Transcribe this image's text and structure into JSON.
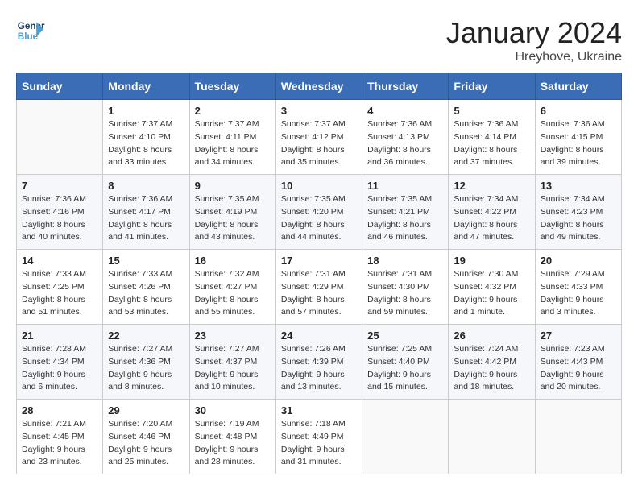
{
  "header": {
    "logo_line1": "General",
    "logo_line2": "Blue",
    "month_year": "January 2024",
    "location": "Hreyhove, Ukraine"
  },
  "days_of_week": [
    "Sunday",
    "Monday",
    "Tuesday",
    "Wednesday",
    "Thursday",
    "Friday",
    "Saturday"
  ],
  "weeks": [
    [
      {
        "day": "",
        "sunrise": "",
        "sunset": "",
        "daylight": ""
      },
      {
        "day": "1",
        "sunrise": "Sunrise: 7:37 AM",
        "sunset": "Sunset: 4:10 PM",
        "daylight": "Daylight: 8 hours and 33 minutes."
      },
      {
        "day": "2",
        "sunrise": "Sunrise: 7:37 AM",
        "sunset": "Sunset: 4:11 PM",
        "daylight": "Daylight: 8 hours and 34 minutes."
      },
      {
        "day": "3",
        "sunrise": "Sunrise: 7:37 AM",
        "sunset": "Sunset: 4:12 PM",
        "daylight": "Daylight: 8 hours and 35 minutes."
      },
      {
        "day": "4",
        "sunrise": "Sunrise: 7:36 AM",
        "sunset": "Sunset: 4:13 PM",
        "daylight": "Daylight: 8 hours and 36 minutes."
      },
      {
        "day": "5",
        "sunrise": "Sunrise: 7:36 AM",
        "sunset": "Sunset: 4:14 PM",
        "daylight": "Daylight: 8 hours and 37 minutes."
      },
      {
        "day": "6",
        "sunrise": "Sunrise: 7:36 AM",
        "sunset": "Sunset: 4:15 PM",
        "daylight": "Daylight: 8 hours and 39 minutes."
      }
    ],
    [
      {
        "day": "7",
        "sunrise": "Sunrise: 7:36 AM",
        "sunset": "Sunset: 4:16 PM",
        "daylight": "Daylight: 8 hours and 40 minutes."
      },
      {
        "day": "8",
        "sunrise": "Sunrise: 7:36 AM",
        "sunset": "Sunset: 4:17 PM",
        "daylight": "Daylight: 8 hours and 41 minutes."
      },
      {
        "day": "9",
        "sunrise": "Sunrise: 7:35 AM",
        "sunset": "Sunset: 4:19 PM",
        "daylight": "Daylight: 8 hours and 43 minutes."
      },
      {
        "day": "10",
        "sunrise": "Sunrise: 7:35 AM",
        "sunset": "Sunset: 4:20 PM",
        "daylight": "Daylight: 8 hours and 44 minutes."
      },
      {
        "day": "11",
        "sunrise": "Sunrise: 7:35 AM",
        "sunset": "Sunset: 4:21 PM",
        "daylight": "Daylight: 8 hours and 46 minutes."
      },
      {
        "day": "12",
        "sunrise": "Sunrise: 7:34 AM",
        "sunset": "Sunset: 4:22 PM",
        "daylight": "Daylight: 8 hours and 47 minutes."
      },
      {
        "day": "13",
        "sunrise": "Sunrise: 7:34 AM",
        "sunset": "Sunset: 4:23 PM",
        "daylight": "Daylight: 8 hours and 49 minutes."
      }
    ],
    [
      {
        "day": "14",
        "sunrise": "Sunrise: 7:33 AM",
        "sunset": "Sunset: 4:25 PM",
        "daylight": "Daylight: 8 hours and 51 minutes."
      },
      {
        "day": "15",
        "sunrise": "Sunrise: 7:33 AM",
        "sunset": "Sunset: 4:26 PM",
        "daylight": "Daylight: 8 hours and 53 minutes."
      },
      {
        "day": "16",
        "sunrise": "Sunrise: 7:32 AM",
        "sunset": "Sunset: 4:27 PM",
        "daylight": "Daylight: 8 hours and 55 minutes."
      },
      {
        "day": "17",
        "sunrise": "Sunrise: 7:31 AM",
        "sunset": "Sunset: 4:29 PM",
        "daylight": "Daylight: 8 hours and 57 minutes."
      },
      {
        "day": "18",
        "sunrise": "Sunrise: 7:31 AM",
        "sunset": "Sunset: 4:30 PM",
        "daylight": "Daylight: 8 hours and 59 minutes."
      },
      {
        "day": "19",
        "sunrise": "Sunrise: 7:30 AM",
        "sunset": "Sunset: 4:32 PM",
        "daylight": "Daylight: 9 hours and 1 minute."
      },
      {
        "day": "20",
        "sunrise": "Sunrise: 7:29 AM",
        "sunset": "Sunset: 4:33 PM",
        "daylight": "Daylight: 9 hours and 3 minutes."
      }
    ],
    [
      {
        "day": "21",
        "sunrise": "Sunrise: 7:28 AM",
        "sunset": "Sunset: 4:34 PM",
        "daylight": "Daylight: 9 hours and 6 minutes."
      },
      {
        "day": "22",
        "sunrise": "Sunrise: 7:27 AM",
        "sunset": "Sunset: 4:36 PM",
        "daylight": "Daylight: 9 hours and 8 minutes."
      },
      {
        "day": "23",
        "sunrise": "Sunrise: 7:27 AM",
        "sunset": "Sunset: 4:37 PM",
        "daylight": "Daylight: 9 hours and 10 minutes."
      },
      {
        "day": "24",
        "sunrise": "Sunrise: 7:26 AM",
        "sunset": "Sunset: 4:39 PM",
        "daylight": "Daylight: 9 hours and 13 minutes."
      },
      {
        "day": "25",
        "sunrise": "Sunrise: 7:25 AM",
        "sunset": "Sunset: 4:40 PM",
        "daylight": "Daylight: 9 hours and 15 minutes."
      },
      {
        "day": "26",
        "sunrise": "Sunrise: 7:24 AM",
        "sunset": "Sunset: 4:42 PM",
        "daylight": "Daylight: 9 hours and 18 minutes."
      },
      {
        "day": "27",
        "sunrise": "Sunrise: 7:23 AM",
        "sunset": "Sunset: 4:43 PM",
        "daylight": "Daylight: 9 hours and 20 minutes."
      }
    ],
    [
      {
        "day": "28",
        "sunrise": "Sunrise: 7:21 AM",
        "sunset": "Sunset: 4:45 PM",
        "daylight": "Daylight: 9 hours and 23 minutes."
      },
      {
        "day": "29",
        "sunrise": "Sunrise: 7:20 AM",
        "sunset": "Sunset: 4:46 PM",
        "daylight": "Daylight: 9 hours and 25 minutes."
      },
      {
        "day": "30",
        "sunrise": "Sunrise: 7:19 AM",
        "sunset": "Sunset: 4:48 PM",
        "daylight": "Daylight: 9 hours and 28 minutes."
      },
      {
        "day": "31",
        "sunrise": "Sunrise: 7:18 AM",
        "sunset": "Sunset: 4:49 PM",
        "daylight": "Daylight: 9 hours and 31 minutes."
      },
      {
        "day": "",
        "sunrise": "",
        "sunset": "",
        "daylight": ""
      },
      {
        "day": "",
        "sunrise": "",
        "sunset": "",
        "daylight": ""
      },
      {
        "day": "",
        "sunrise": "",
        "sunset": "",
        "daylight": ""
      }
    ]
  ]
}
